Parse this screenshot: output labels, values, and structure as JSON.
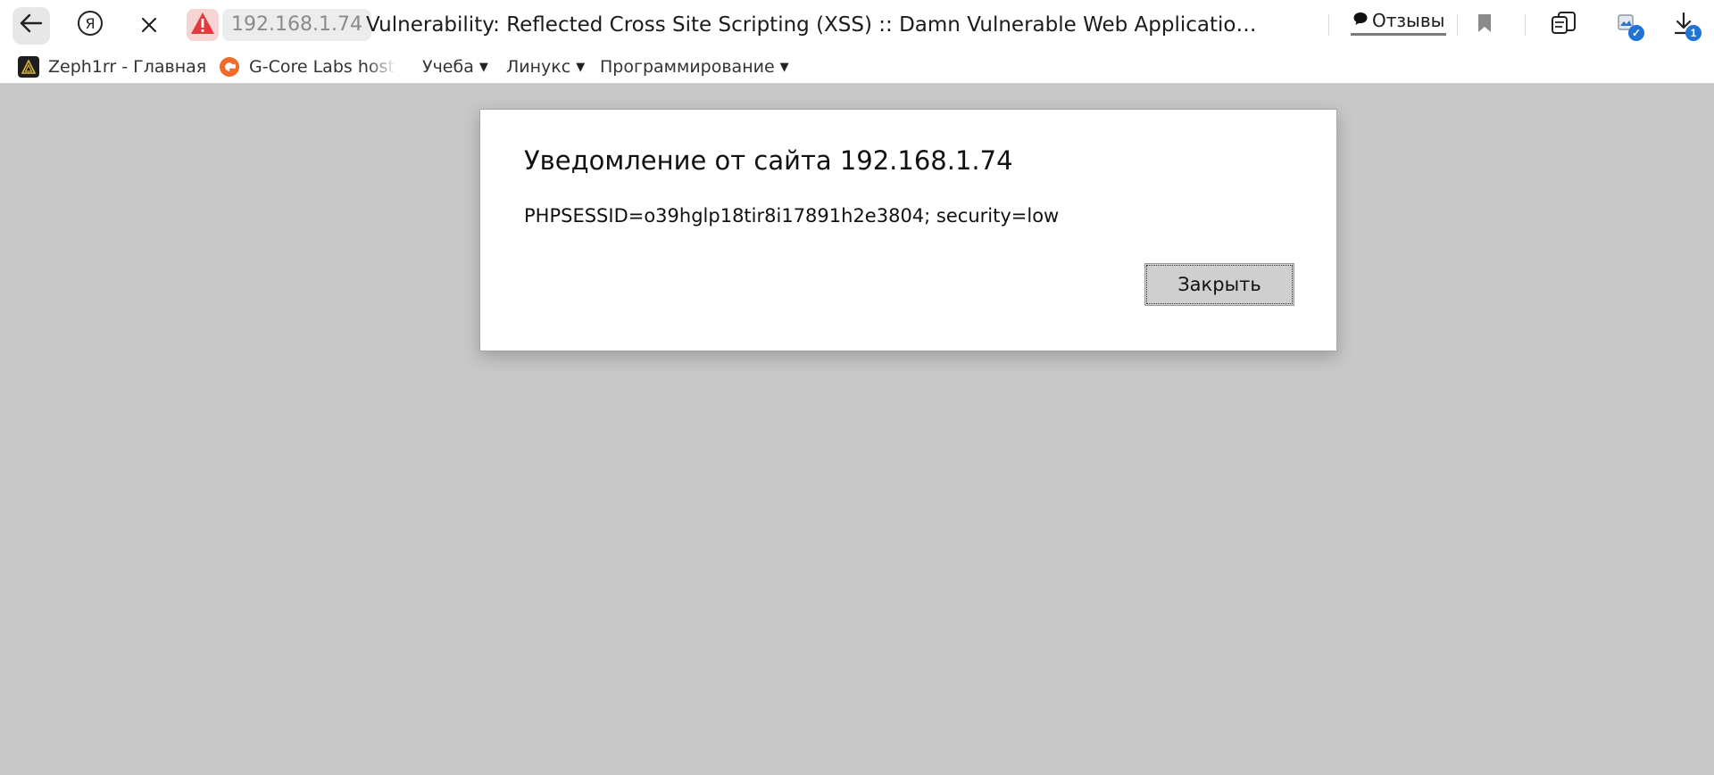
{
  "toolbar": {
    "host": "192.168.1.74",
    "title": "Vulnerability: Reflected Cross Site Scripting (XSS) :: Damn Vulnerable Web Application (DVWA)...",
    "reviews_label": "Отзывы",
    "downloads_badge": "1",
    "icons": {
      "back": "back-arrow-icon",
      "yandex": "yandex-logo-icon",
      "stop": "close-icon",
      "warning": "warning-triangle-icon",
      "reviews": "speech-bubble-icon",
      "bookmark": "bookmark-icon",
      "tabs": "tabs-icon",
      "screenshot": "screenshot-icon",
      "downloads": "download-icon"
    }
  },
  "bookmarks": [
    {
      "label": "Zeph1rr - Главная",
      "icon": "zeph1rr-favicon"
    },
    {
      "label": "G-Core Labs hosting",
      "icon": "gcore-favicon"
    },
    {
      "label": "Учеба",
      "folder": true
    },
    {
      "label": "Линукс",
      "folder": true
    },
    {
      "label": "Программирование",
      "folder": true
    }
  ],
  "dialog": {
    "title": "Уведомление от сайта 192.168.1.74",
    "message": "PHPSESSID=o39hglp18tir8i17891h2e3804; security=low",
    "close_label": "Закрыть"
  },
  "colors": {
    "page_overlay": "#c8c8c8",
    "warning_red": "#e23b3b",
    "badge_blue": "#1f74d6"
  }
}
